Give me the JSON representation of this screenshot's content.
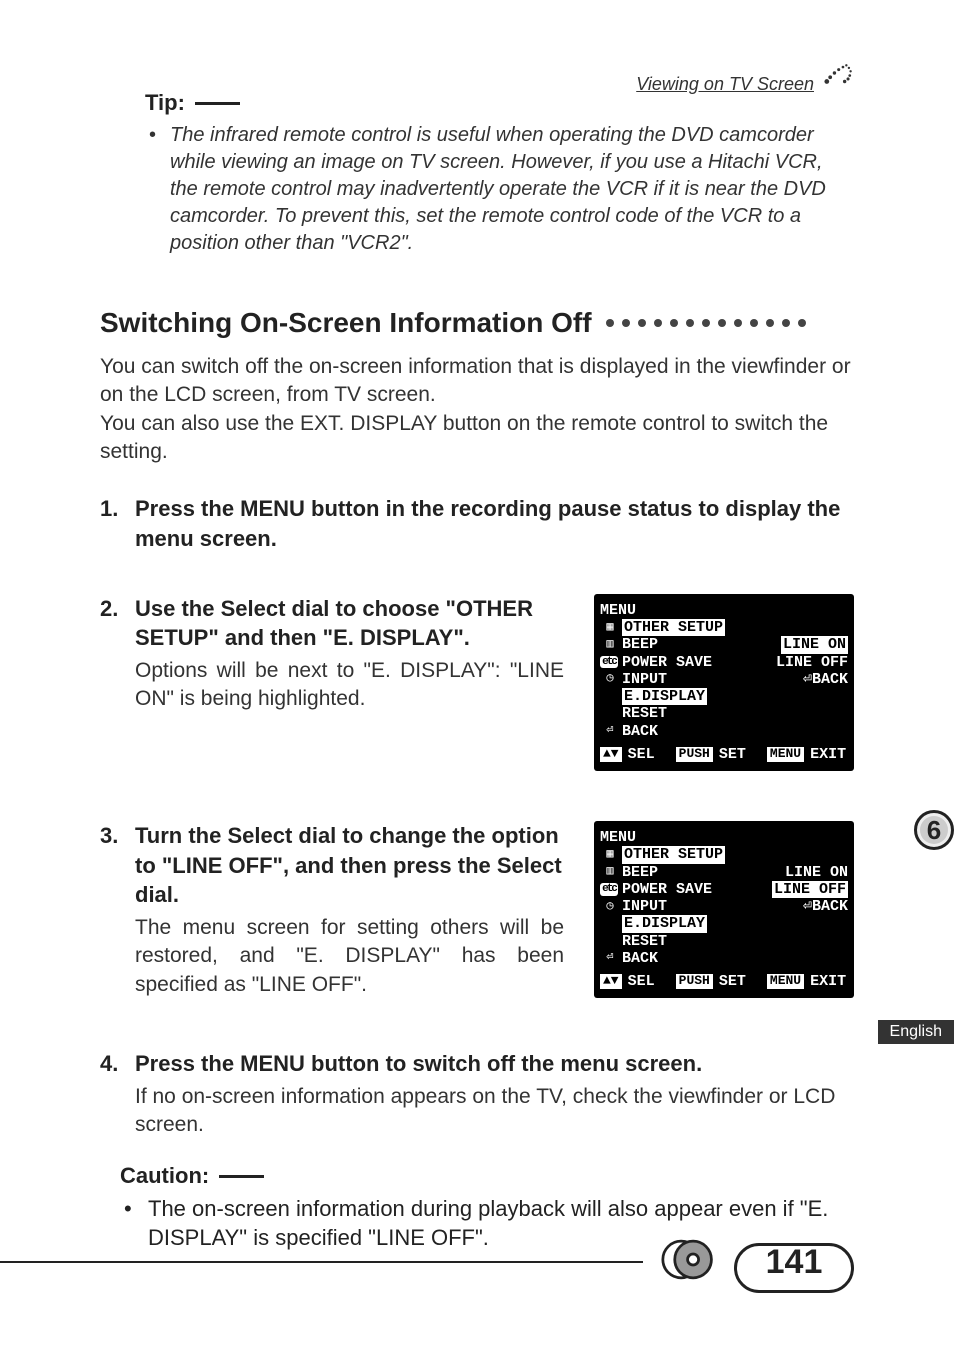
{
  "header": {
    "section": "Viewing on TV Screen"
  },
  "tip": {
    "label": "Tip:",
    "text": "The infrared remote control is useful when operating the DVD camcorder while viewing an image on TV screen. However, if you use a Hitachi VCR, the remote control may inadvertently operate the VCR if it is near the DVD camcorder. To prevent this, set the remote control code of the VCR to a position other than \"VCR2\"."
  },
  "section_title": "Switching On-Screen Information Off",
  "intro": "You can switch off the on-screen information that is displayed in the viewfinder or on the LCD screen, from TV screen.\nYou can also use the EXT. DISPLAY button on the remote control to switch the setting.",
  "steps": [
    {
      "num": "1.",
      "bold": "Press the MENU button in the recording pause status to display the menu screen."
    },
    {
      "num": "2.",
      "bold": "Use the Select dial to choose \"OTHER SETUP\" and then \"E. DISPLAY\".",
      "desc": "Options will be next to \"E. DISPLAY\": \"LINE ON\" is being highlighted."
    },
    {
      "num": "3.",
      "bold": "Turn the Select dial to change the option to \"LINE OFF\", and then press the Select dial.",
      "desc": "The menu screen for setting others will be restored, and \"E. DISPLAY\" has been specified as \"LINE OFF\"."
    },
    {
      "num": "4.",
      "bold": "Press the MENU button to switch off the menu screen.",
      "desc": "If no on-screen information appears on the TV, check the viewfinder or LCD screen."
    }
  ],
  "menu_shots": [
    {
      "title": "MENU",
      "section": "OTHER SETUP",
      "items": [
        "BEEP",
        "POWER SAVE",
        "INPUT",
        "E.DISPLAY",
        "RESET",
        "BACK"
      ],
      "highlight_item": "E.DISPLAY",
      "options": [
        "LINE ON",
        "LINE OFF",
        "BACK"
      ],
      "highlight_option": "LINE ON",
      "footer": {
        "sel": "SEL",
        "push": "PUSH",
        "set": "SET",
        "menu": "MENU",
        "exit": "EXIT"
      }
    },
    {
      "title": "MENU",
      "section": "OTHER SETUP",
      "items": [
        "BEEP",
        "POWER SAVE",
        "INPUT",
        "E.DISPLAY",
        "RESET",
        "BACK"
      ],
      "highlight_item": "E.DISPLAY",
      "options": [
        "LINE ON",
        "LINE OFF",
        "BACK"
      ],
      "highlight_option": "LINE OFF",
      "footer": {
        "sel": "SEL",
        "push": "PUSH",
        "set": "SET",
        "menu": "MENU",
        "exit": "EXIT"
      }
    }
  ],
  "caution": {
    "label": "Caution:",
    "text": "The on-screen information during playback will also appear even if \"E. DISPLAY\" is specified \"LINE OFF\"."
  },
  "side": {
    "chapter": "6",
    "lang": "English"
  },
  "page_number": "141"
}
